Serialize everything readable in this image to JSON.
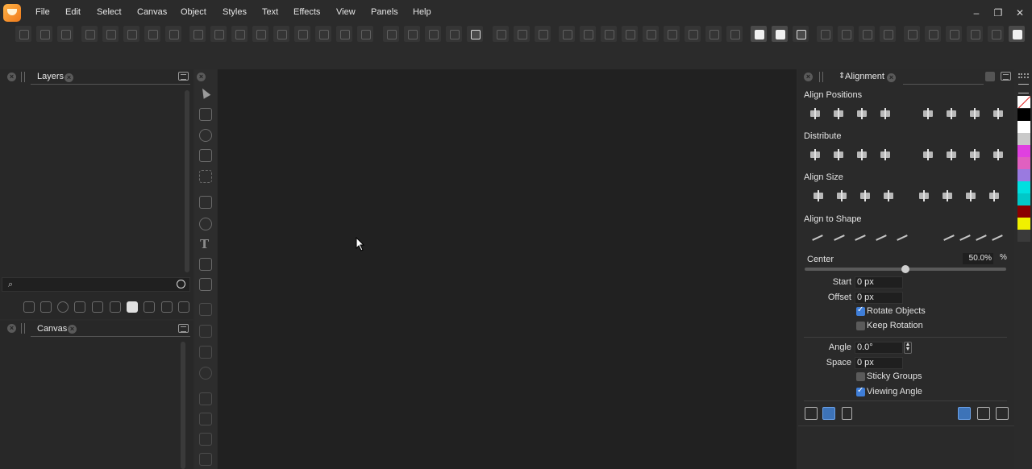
{
  "menu": [
    "File",
    "Edit",
    "Select",
    "Canvas",
    "Object",
    "Styles",
    "Text",
    "Effects",
    "View",
    "Panels",
    "Help"
  ],
  "window_controls": {
    "minimize": "–",
    "restore": "❐",
    "close": "✕"
  },
  "layers_panel": {
    "tab_label": "Layers",
    "search_placeholder": ""
  },
  "canvas_panel": {
    "tab_label": "Canvas"
  },
  "alignment_panel": {
    "tab_label": "Alignment",
    "sections": {
      "align_positions": "Align Positions",
      "distribute": "Distribute",
      "align_size": "Align Size",
      "align_to_shape": "Align to Shape"
    },
    "center_label": "Center",
    "center_value": "50.0%",
    "center_unit": "%",
    "center_slider_fraction": 0.5,
    "start_label": "Start",
    "start_value": "0 px",
    "offset_label": "Offset",
    "offset_value": "0 px",
    "rotate_objects_label": "Rotate Objects",
    "rotate_objects_checked": true,
    "keep_rotation_label": "Keep Rotation",
    "keep_rotation_checked": false,
    "angle_label": "Angle",
    "angle_value": "0.0°",
    "space_label": "Space",
    "space_value": "0 px",
    "sticky_groups_label": "Sticky Groups",
    "sticky_groups_checked": false,
    "viewing_angle_label": "Viewing Angle",
    "viewing_angle_checked": true
  },
  "color_swatches": [
    "#ffffff",
    "#000000",
    "#ffffff",
    "#c9c9c9",
    "#e040e0",
    "#e060c0",
    "#9a7ae0",
    "#00e0e0",
    "#00c8c8",
    "#8a0000",
    "#f0f000",
    "#3a3a3a"
  ],
  "colors": {
    "accent": "#3f7ed8",
    "background": "#2b2b2b",
    "canvas": "#212121"
  }
}
